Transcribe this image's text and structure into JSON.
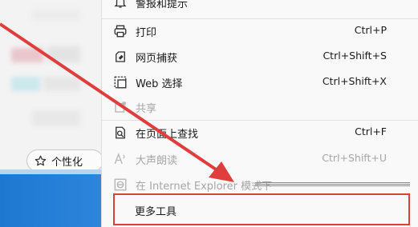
{
  "background": {
    "personalize_label": "个性化"
  },
  "menu": {
    "items": [
      {
        "label": "警报和提示",
        "key": "",
        "icon": "bell-icon",
        "disabled": false
      },
      {
        "label": "打印",
        "key": "Ctrl+P",
        "icon": "printer-icon",
        "disabled": false
      },
      {
        "label": "网页捕获",
        "key": "Ctrl+Shift+S",
        "icon": "web-capture-icon",
        "disabled": false
      },
      {
        "label": "Web 选择",
        "key": "Ctrl+Shift+X",
        "icon": "web-select-icon",
        "disabled": false
      },
      {
        "label": "共享",
        "key": "",
        "icon": "share-icon",
        "disabled": true
      },
      {
        "label": "在页面上查找",
        "key": "Ctrl+F",
        "icon": "find-icon",
        "disabled": false
      },
      {
        "label": "大声朗读",
        "key": "Ctrl+Shift+U",
        "icon": "read-aloud-icon",
        "disabled": true
      },
      {
        "label": "在 Internet Explorer 模式下",
        "key": "",
        "icon": "ie-icon",
        "disabled": true
      },
      {
        "label": "更多工具",
        "key": "",
        "icon": "",
        "disabled": false
      }
    ]
  },
  "colors": {
    "annotation_red": "#e03d3d",
    "menu_background": "#f9f9f9",
    "disabled_text": "#a6a6a6"
  }
}
